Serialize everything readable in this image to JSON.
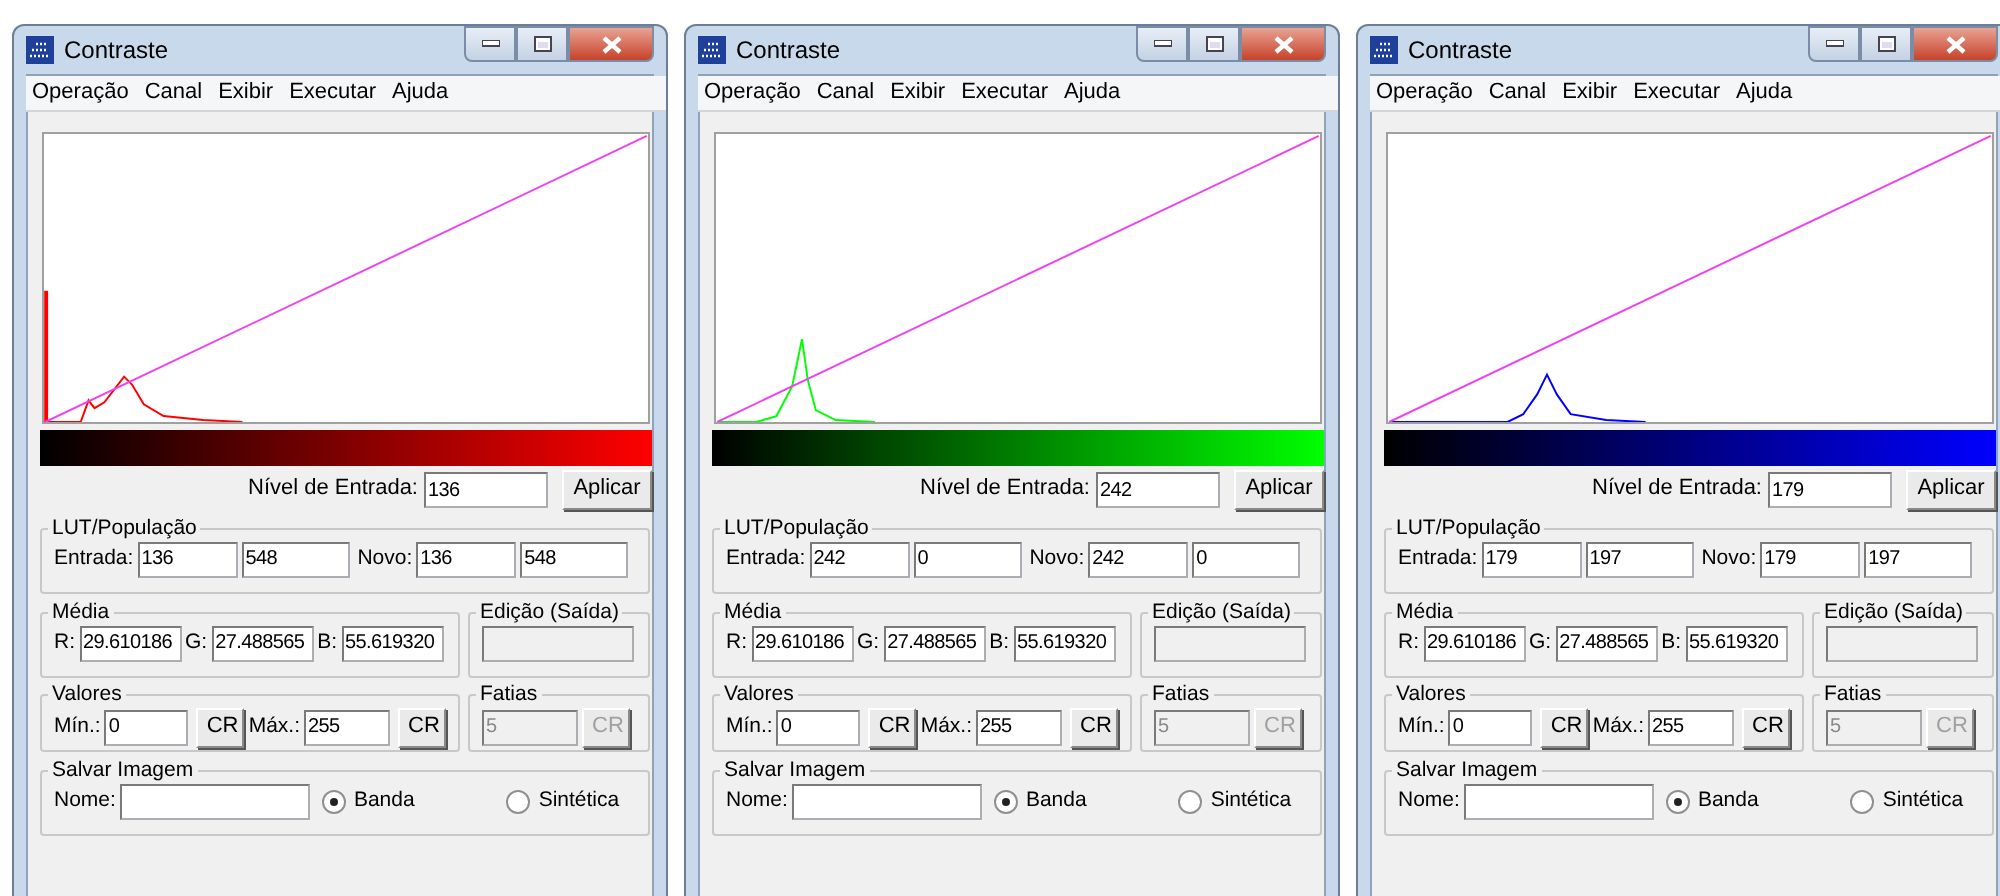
{
  "windows": [
    {
      "title": "Contraste",
      "menu": [
        "Operação",
        "Canal",
        "Exibir",
        "Executar",
        "Ajuda"
      ],
      "color": "#ff0000",
      "nivel": {
        "label": "Nível de Entrada:",
        "value": "136",
        "button": "Aplicar"
      },
      "lut": {
        "title": "LUT/População",
        "entrada_label": "Entrada:",
        "entrada": [
          "136",
          "548"
        ],
        "novo_label": "Novo:",
        "novo": [
          "136",
          "548"
        ]
      },
      "media": {
        "title": "Média",
        "fields": [
          {
            "label": "R:",
            "value": "29.610186"
          },
          {
            "label": "G:",
            "value": "27.488565"
          },
          {
            "label": "B:",
            "value": "55.619320"
          }
        ]
      },
      "edicao": {
        "title": "Edição (Saída)",
        "disabled": true
      },
      "valores": {
        "title": "Valores",
        "min_label": "Mín.:",
        "min": "0",
        "min_button": "CR",
        "max_label": "Máx.:",
        "max": "255",
        "max_button": "CR"
      },
      "fatias": {
        "title": "Fatias",
        "value": "5",
        "button": "CR",
        "disabled": true
      },
      "salvar": {
        "title": "Salvar Imagem",
        "nome_label": "Nome:",
        "options": [
          {
            "label": "Banda",
            "selected": true
          },
          {
            "label": "Sintética",
            "selected": false
          }
        ]
      }
    },
    {
      "title": "Contraste",
      "menu": [
        "Operação",
        "Canal",
        "Exibir",
        "Executar",
        "Ajuda"
      ],
      "color": "#00ff00",
      "nivel": {
        "label": "Nível de Entrada:",
        "value": "242",
        "button": "Aplicar"
      },
      "lut": {
        "title": "LUT/População",
        "entrada_label": "Entrada:",
        "entrada": [
          "242",
          "0"
        ],
        "novo_label": "Novo:",
        "novo": [
          "242",
          "0"
        ]
      },
      "media": {
        "title": "Média",
        "fields": [
          {
            "label": "R:",
            "value": "29.610186"
          },
          {
            "label": "G:",
            "value": "27.488565"
          },
          {
            "label": "B:",
            "value": "55.619320"
          }
        ]
      },
      "edicao": {
        "title": "Edição (Saída)",
        "disabled": true
      },
      "valores": {
        "title": "Valores",
        "min_label": "Mín.:",
        "min": "0",
        "min_button": "CR",
        "max_label": "Máx.:",
        "max": "255",
        "max_button": "CR"
      },
      "fatias": {
        "title": "Fatias",
        "value": "5",
        "button": "CR",
        "disabled": true
      },
      "salvar": {
        "title": "Salvar Imagem",
        "nome_label": "Nome:",
        "options": [
          {
            "label": "Banda",
            "selected": true
          },
          {
            "label": "Sintética",
            "selected": false
          }
        ]
      }
    },
    {
      "title": "Contraste",
      "menu": [
        "Operação",
        "Canal",
        "Exibir",
        "Executar",
        "Ajuda"
      ],
      "color": "#0000ff",
      "nivel": {
        "label": "Nível de Entrada:",
        "value": "179",
        "button": "Aplicar"
      },
      "lut": {
        "title": "LUT/População",
        "entrada_label": "Entrada:",
        "entrada": [
          "179",
          "197"
        ],
        "novo_label": "Novo:",
        "novo": [
          "179",
          "197"
        ]
      },
      "media": {
        "title": "Média",
        "fields": [
          {
            "label": "R:",
            "value": "29.610186"
          },
          {
            "label": "G:",
            "value": "27.488565"
          },
          {
            "label": "B:",
            "value": "55.619320"
          }
        ]
      },
      "edicao": {
        "title": "Edição (Saída)",
        "disabled": true
      },
      "valores": {
        "title": "Valores",
        "min_label": "Mín.:",
        "min": "0",
        "min_button": "CR",
        "max_label": "Máx.:",
        "max": "255",
        "max_button": "CR"
      },
      "fatias": {
        "title": "Fatias",
        "value": "5",
        "button": "CR",
        "disabled": true
      },
      "salvar": {
        "title": "Salvar Imagem",
        "nome_label": "Nome:",
        "options": [
          {
            "label": "Banda",
            "selected": true
          },
          {
            "label": "Sintética",
            "selected": false
          }
        ]
      }
    }
  ]
}
